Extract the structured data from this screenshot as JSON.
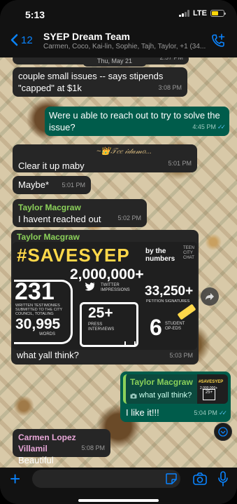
{
  "status": {
    "time": "5:13",
    "network": "LTE"
  },
  "header": {
    "back_count": "12",
    "title": "SYEP Dream Team",
    "members": "Carmen, Coco, Kai-lin, Sophie, Tajh, Taylor, +1 (34..."
  },
  "chat": {
    "date_pill": "Thu, May 21",
    "prev_time": "2:57 PM",
    "messages": [
      {
        "text": "couple small issues -- says stipends \"capped\" at $1k",
        "time": "3:08 PM"
      },
      {
        "text": "Were u able to reach out to try to solve the issue?",
        "time": "4:45 PM"
      },
      {
        "sender": "~👑𝒯𝑒𝑒  𝒾𝒹𝒶𝓂𝑜...",
        "text": "Clear it up maby",
        "time": "5:01 PM"
      },
      {
        "text": "Maybe*",
        "time": "5:01 PM"
      },
      {
        "sender": "Taylor Macgraw",
        "text": "I havent reached out",
        "time": "5:02 PM"
      },
      {
        "sender": "Taylor Macgraw",
        "text": "what yall think?",
        "time": "5:03 PM"
      },
      {
        "text": "I like it!!!",
        "time": "5:04 PM"
      },
      {
        "sender": "Carmen Lopez Villamil",
        "text": "Beautiful",
        "time": "5:08 PM"
      }
    ],
    "reply_quote": {
      "name": "Taylor Macgraw",
      "text": "what yall think?"
    }
  },
  "poster": {
    "title": "#SAVESYEP",
    "by_line": "by the numbers",
    "logo": "TEEN CITY CHAT",
    "impressions": "2,000,000+",
    "impressions_label": "TWITTER IMPRESSIONS",
    "testimonies": "231",
    "testimonies_label": "WRITTEN TESTIMONIES SUBMITTED TO THE CITY COUNCIL, TOTALING",
    "words": "30,995",
    "words_label": "WORDS",
    "signatures": "33,250+",
    "signatures_label": "PETITION SIGNATURES",
    "interviews": "25+",
    "interviews_label": "PRESS INTERVIEWS",
    "opeds": "6",
    "opeds_label": "STUDENT OP-EDS"
  },
  "input": {
    "placeholder": ""
  },
  "icons": {
    "accent": "#0a84ff",
    "outgoing_bubble": "#005c4b",
    "incoming_bubble": "#262626",
    "sender_green": "#8bd15a",
    "sender_pink": "#e8a7d8"
  }
}
